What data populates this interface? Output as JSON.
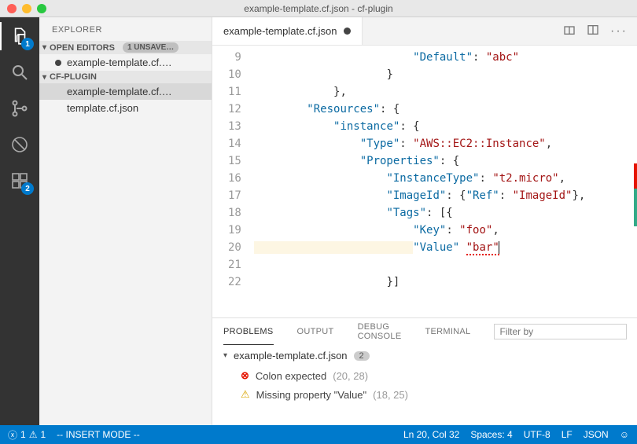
{
  "window": {
    "title": "example-template.cf.json - cf-plugin"
  },
  "activity": {
    "badge_explorer": "1",
    "badge_debug": "2"
  },
  "sidebar": {
    "header": "EXPLORER",
    "sections": {
      "open_editors": "OPEN EDITORS",
      "unsaved": "1 UNSAVE…",
      "project": "CF-PLUGIN"
    },
    "items": {
      "open_unsaved": "example-template.cf.…",
      "proj_file1": "example-template.cf.…",
      "proj_file2": "template.cf.json"
    }
  },
  "tabs": {
    "active": "example-template.cf.json"
  },
  "code": {
    "lines": [
      {
        "n": "9",
        "html": "                        <span class='tok-key'>\"Default\"</span>: <span class='tok-str'>\"abc\"</span>"
      },
      {
        "n": "10",
        "html": "                    <span class='tok-brace'>}</span>"
      },
      {
        "n": "11",
        "html": "            <span class='tok-brace'>}</span>,"
      },
      {
        "n": "12",
        "html": "        <span class='tok-key'>\"Resources\"</span>: <span class='tok-brace'>{</span>"
      },
      {
        "n": "13",
        "html": "            <span class='tok-key'>\"instance\"</span>: <span class='tok-brace'>{</span>"
      },
      {
        "n": "14",
        "html": "                <span class='tok-key'>\"Type\"</span>: <span class='tok-str'>\"AWS::EC2::Instance\"</span>,"
      },
      {
        "n": "15",
        "html": "                <span class='tok-key'>\"Properties\"</span>: <span class='tok-brace'>{</span>"
      },
      {
        "n": "16",
        "html": "                    <span class='tok-key'>\"InstanceType\"</span>: <span class='tok-str'>\"t2.micro\"</span>,"
      },
      {
        "n": "17",
        "html": "                    <span class='tok-key'>\"ImageId\"</span>: <span class='tok-brace'>{</span><span class='tok-key'>\"Ref\"</span>: <span class='tok-str'>\"ImageId\"</span><span class='tok-brace'>}</span>,"
      },
      {
        "n": "18",
        "html": "                    <span class='tok-key'>\"Tags\"</span>: <span class='tok-brace'>[{</span>"
      },
      {
        "n": "19",
        "html": "                        <span class='tok-key'>\"Key\"</span>: <span class='tok-str'>\"foo\"</span>,"
      },
      {
        "n": "20",
        "html": "<span class='tok-hl'>                        </span><span class='tok-key'>\"Value\"</span> <span class='tok-str err-underline'>\"bar\"</span><span class='cursor'></span>"
      },
      {
        "n": "21",
        "html": ""
      },
      {
        "n": "22",
        "html": "                    <span class='tok-brace'>}]</span>"
      }
    ]
  },
  "panel": {
    "tabs": {
      "problems": "PROBLEMS",
      "output": "OUTPUT",
      "debug": "DEBUG CONSOLE",
      "terminal": "TERMINAL"
    },
    "filter_placeholder": "Filter by",
    "file": "example-template.cf.json",
    "count": "2",
    "problems": [
      {
        "sev": "error",
        "msg": "Colon expected",
        "loc": "(20, 28)"
      },
      {
        "sev": "warn",
        "msg": "Missing property \"Value\"",
        "loc": "(18, 25)"
      }
    ]
  },
  "status": {
    "errors": "1",
    "warnings": "1",
    "mode": "-- INSERT MODE --",
    "pos": "Ln 20, Col 32",
    "spaces": "Spaces: 4",
    "encoding": "UTF-8",
    "eol": "LF",
    "lang": "JSON"
  }
}
